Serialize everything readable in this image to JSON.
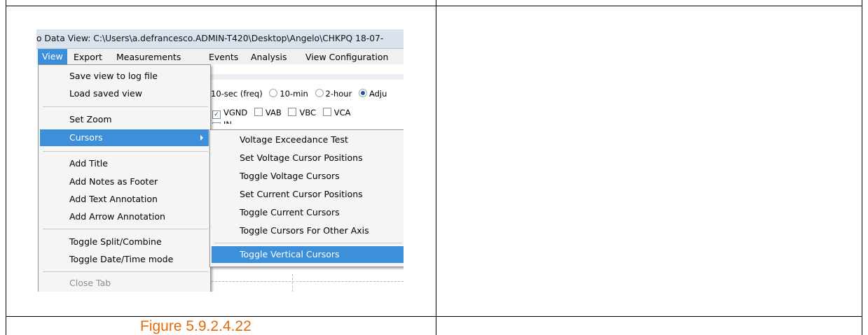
{
  "window": {
    "title": "o Data View: C:\\Users\\a.defrancesco.ADMIN-T420\\Desktop\\Angelo\\CHKPQ 18-07-"
  },
  "menubar": {
    "items": [
      "View",
      "Export",
      "Measurements",
      "Events",
      "Analysis",
      "View Configuration"
    ]
  },
  "background": {
    "interval_options": [
      "10-sec (freq)",
      "10-min",
      "2-hour",
      "Adju"
    ],
    "selected_interval": "Adju",
    "channels": [
      {
        "label": "VGND",
        "checked": true
      },
      {
        "label": "VAB",
        "checked": false
      },
      {
        "label": "VBC",
        "checked": false
      },
      {
        "label": "VCA",
        "checked": false
      }
    ],
    "channel_row2": "IN"
  },
  "view_menu": {
    "items": [
      {
        "label": "Save view to log file"
      },
      {
        "label": "Load saved view"
      },
      {
        "label": "Set Zoom"
      },
      {
        "label": "Cursors",
        "selected": true,
        "submenu": true
      },
      {
        "label": "Add Title"
      },
      {
        "label": "Add Notes as Footer"
      },
      {
        "label": "Add Text Annotation"
      },
      {
        "label": "Add Arrow Annotation"
      },
      {
        "label": "Toggle Split/Combine"
      },
      {
        "label": "Toggle Date/Time mode"
      },
      {
        "label": "Close Tab",
        "disabled": true
      }
    ]
  },
  "cursors_submenu": {
    "items": [
      {
        "label": "Voltage Exceedance Test"
      },
      {
        "label": "Set Voltage Cursor Positions"
      },
      {
        "label": "Toggle Voltage Cursors"
      },
      {
        "label": "Set Current Cursor Positions"
      },
      {
        "label": "Toggle Current Cursors"
      },
      {
        "label": "Toggle Cursors For Other Axis"
      },
      {
        "label": "Toggle Vertical Cursors",
        "selected": true
      }
    ]
  },
  "caption": "Figure 5.9.2.4.22",
  "colors": {
    "highlight": "#3e8fd9",
    "caption": "#e36c09",
    "titlebar": "#d9e2ed"
  }
}
